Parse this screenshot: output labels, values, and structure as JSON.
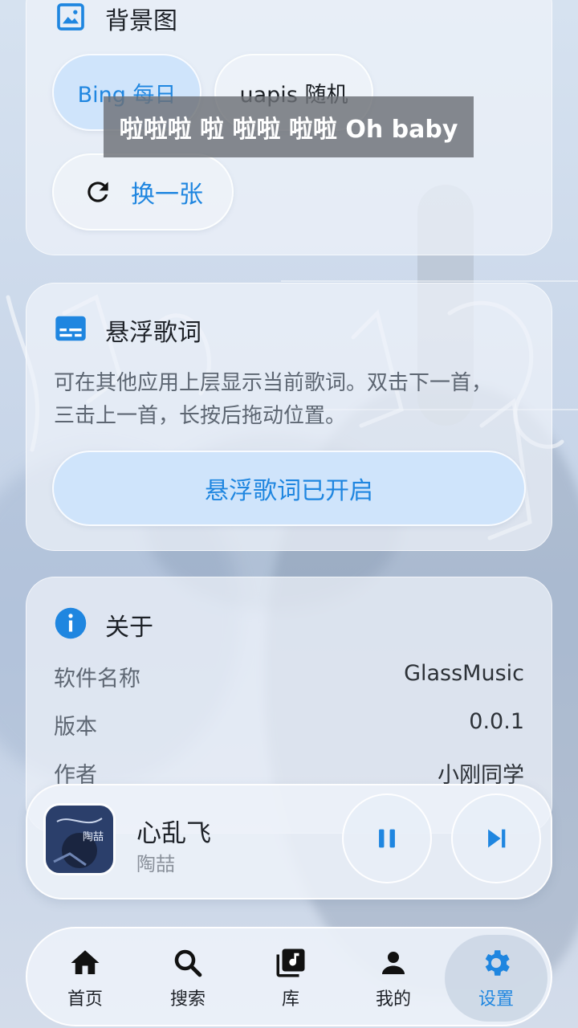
{
  "background_card": {
    "title": "背景图",
    "icon": "image-icon",
    "options": [
      "Bing 每日",
      "uapis 随机"
    ],
    "refresh_label": "换一张"
  },
  "floating_lyric_overlay": "啦啦啦 啦 啦啦 啦啦 Oh baby",
  "floating_lyrics_card": {
    "title": "悬浮歌词",
    "icon": "subtitles-icon",
    "description": "可在其他应用上层显示当前歌词。双击下一首，三击上一首，长按后拖动位置。",
    "button_label": "悬浮歌词已开启"
  },
  "about_card": {
    "title": "关于",
    "icon": "info-icon",
    "rows": [
      {
        "key": "软件名称",
        "value": "GlassMusic"
      },
      {
        "key": "版本",
        "value": "0.0.1"
      },
      {
        "key": "作者",
        "value": "小刚同学"
      }
    ]
  },
  "now_playing": {
    "title": "心乱飞",
    "artist": "陶喆",
    "cover_text": "陶喆"
  },
  "nav": [
    {
      "label": "首页",
      "icon": "home-icon"
    },
    {
      "label": "搜索",
      "icon": "search-icon"
    },
    {
      "label": "库",
      "icon": "library-music-icon"
    },
    {
      "label": "我的",
      "icon": "person-icon"
    },
    {
      "label": "设置",
      "icon": "settings-icon"
    }
  ],
  "colors": {
    "accent": "#1f86e0",
    "active_pill_bg": "#cfe4fb"
  }
}
